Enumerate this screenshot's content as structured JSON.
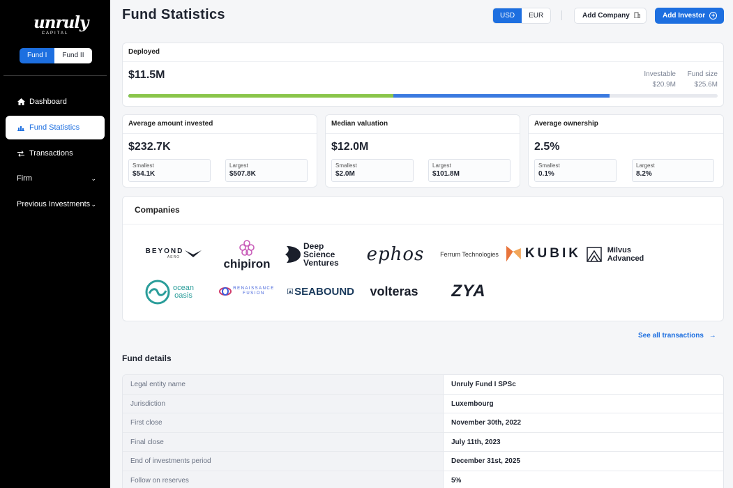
{
  "sidebar": {
    "logo_word": "unruly",
    "logo_sub": "CAPITAL",
    "fund_tabs": [
      "Fund I",
      "Fund II"
    ],
    "nav": {
      "dashboard": "Dashboard",
      "fund_statistics": "Fund Statistics",
      "transactions": "Transactions",
      "firm": "Firm",
      "previous_investments": "Previous Investments"
    }
  },
  "header": {
    "title": "Fund Statistics",
    "currencies": [
      "USD",
      "EUR"
    ],
    "add_company": "Add Company",
    "add_investor": "Add Investor"
  },
  "deployed": {
    "label": "Deployed",
    "amount": "$11.5M",
    "investable_label": "Investable",
    "investable_value": "$20.9M",
    "fund_size_label": "Fund size",
    "fund_size_value": "$25.6M",
    "deployed_share_of_fund": 0.45,
    "investable_share_of_fund": 0.816
  },
  "stats": [
    {
      "title": "Average amount invested",
      "value": "$232.7K",
      "smallest_label": "Smallest",
      "smallest": "$54.1K",
      "largest_label": "Largest",
      "largest": "$507.8K"
    },
    {
      "title": "Median valuation",
      "value": "$12.0M",
      "smallest_label": "Smallest",
      "smallest": "$2.0M",
      "largest_label": "Largest",
      "largest": "$101.8M"
    },
    {
      "title": "Average ownership",
      "value": "2.5%",
      "smallest_label": "Smallest",
      "smallest": "0.1%",
      "largest_label": "Largest",
      "largest": "8.2%"
    }
  ],
  "companies": {
    "title": "Companies",
    "logos": {
      "beyond": "BEYOND",
      "beyond_sub": "AERO",
      "chipiron": "chipiron",
      "deep_science_1": "Deep Science",
      "deep_science_2": "Ventures",
      "ephos": "ephos",
      "ferrum": "Ferrum Technologies",
      "kubik": "KUBIK",
      "milvus_1": "Milvus",
      "milvus_2": "Advanced",
      "ocean_1": "ocean",
      "ocean_2": "oasis",
      "renaissance_1": "RENAISSANCE",
      "renaissance_2": "FUSION",
      "seabound": "SEABOUND",
      "volteras": "volteras",
      "zya": "ZYA"
    }
  },
  "see_all": "See all transactions",
  "fund_details": {
    "title": "Fund details",
    "rows": [
      {
        "key": "Legal entity name",
        "value": "Unruly Fund I SPSc"
      },
      {
        "key": "Jurisdiction",
        "value": "Luxembourg"
      },
      {
        "key": "First close",
        "value": "November 30th, 2022"
      },
      {
        "key": "Final close",
        "value": "July 11th, 2023"
      },
      {
        "key": "End of investments period",
        "value": "December 31st, 2025"
      },
      {
        "key": "Follow on reserves",
        "value": "5%"
      }
    ]
  },
  "colors": {
    "accent": "#1d6fe0",
    "deployed_bar": "#8ac54a",
    "investable_bar": "#3b7ae0"
  }
}
